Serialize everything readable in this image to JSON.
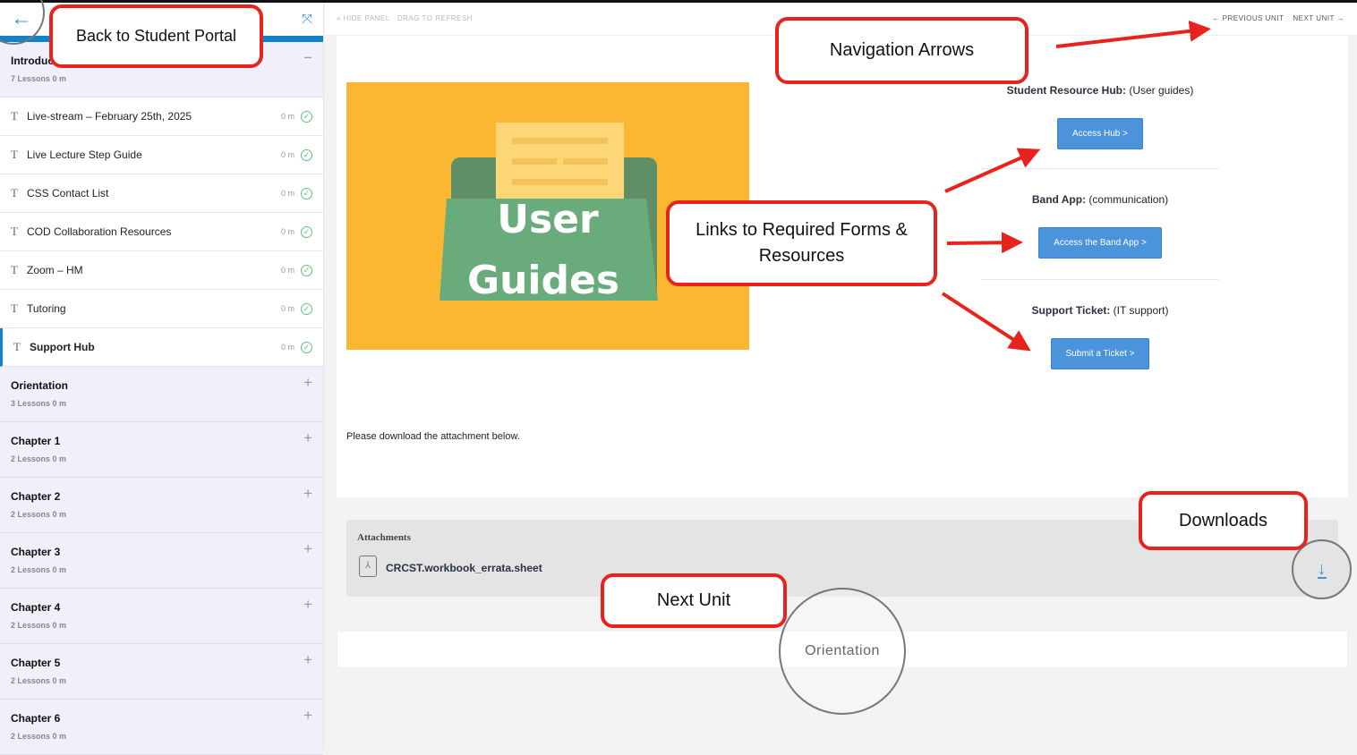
{
  "sidebar": {
    "intro": {
      "title": "Introduction",
      "meta": "7 Lessons  0 m",
      "toggle": "−"
    },
    "lessons": [
      {
        "label": "Live-stream – February 25th, 2025",
        "duration": "0 m"
      },
      {
        "label": "Live Lecture Step Guide",
        "duration": "0 m"
      },
      {
        "label": "CSS Contact List",
        "duration": "0 m"
      },
      {
        "label": "COD Collaboration Resources",
        "duration": "0 m"
      },
      {
        "label": "Zoom – HM",
        "duration": "0 m"
      },
      {
        "label": "Tutoring",
        "duration": "0 m"
      },
      {
        "label": "Support Hub",
        "duration": "0 m"
      }
    ],
    "sections": [
      {
        "title": "Orientation",
        "meta": "3 Lessons  0 m"
      },
      {
        "title": "Chapter 1",
        "meta": "2 Lessons  0 m"
      },
      {
        "title": "Chapter 2",
        "meta": "2 Lessons  0 m"
      },
      {
        "title": "Chapter 3",
        "meta": "2 Lessons  0 m"
      },
      {
        "title": "Chapter 4",
        "meta": "2 Lessons  0 m"
      },
      {
        "title": "Chapter 5",
        "meta": "2 Lessons  0 m"
      },
      {
        "title": "Chapter 6",
        "meta": "2 Lessons  0 m"
      }
    ],
    "toggle_plus": "+"
  },
  "header": {
    "hide_panel": "HIDE PANEL",
    "drag": "DRAG TO REFRESH",
    "prev": "← PREVIOUS UNIT",
    "next": "NEXT UNIT →"
  },
  "content": {
    "image_text": [
      "User",
      "Guides"
    ],
    "resources": [
      {
        "name": "Student Resource Hub:",
        "desc": " (User guides)",
        "button": "Access Hub >"
      },
      {
        "name": "Band App:",
        "desc": " (communication)",
        "button": "Access the Band App >"
      },
      {
        "name": "Support Ticket:",
        "desc": " (IT support)",
        "button": "Submit a Ticket >"
      }
    ],
    "download_note": "Please download the attachment below."
  },
  "attachments": {
    "heading": "Attachments",
    "file": "CRCST.workbook_errata.sheet"
  },
  "next_unit": {
    "label": "Orientation"
  },
  "annotations": {
    "back": "Back to Student Portal",
    "nav": "Navigation Arrows",
    "links": "Links to Required Forms & Resources",
    "downloads": "Downloads",
    "next": "Next Unit"
  },
  "colors": {
    "accent": "#1283c6",
    "button": "#4b94dc",
    "image_bg": "#fbb731",
    "annotation": "#e8231e",
    "check": "#5cc47a"
  }
}
